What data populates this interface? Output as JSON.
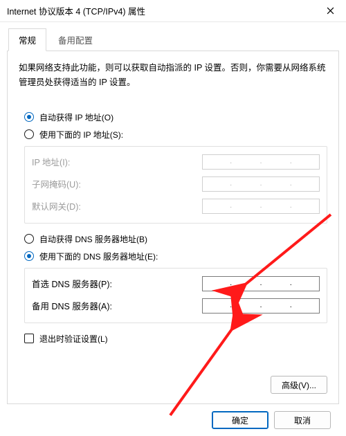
{
  "window": {
    "title": "Internet 协议版本 4 (TCP/IPv4) 属性"
  },
  "tabs": {
    "general": "常规",
    "alternate": "备用配置"
  },
  "description": "如果网络支持此功能，则可以获取自动指派的 IP 设置。否则，你需要从网络系统管理员处获得适当的 IP 设置。",
  "ip": {
    "auto_label": "自动获得 IP 地址(O)",
    "manual_label": "使用下面的 IP 地址(S):",
    "ip_label": "IP 地址(I):",
    "mask_label": "子网掩码(U):",
    "gateway_label": "默认网关(D):"
  },
  "dns": {
    "auto_label": "自动获得 DNS 服务器地址(B)",
    "manual_label": "使用下面的 DNS 服务器地址(E):",
    "preferred_label": "首选 DNS 服务器(P):",
    "alternate_label": "备用 DNS 服务器(A):"
  },
  "validate_label": "退出时验证设置(L)",
  "buttons": {
    "advanced": "高级(V)...",
    "ok": "确定",
    "cancel": "取消"
  }
}
